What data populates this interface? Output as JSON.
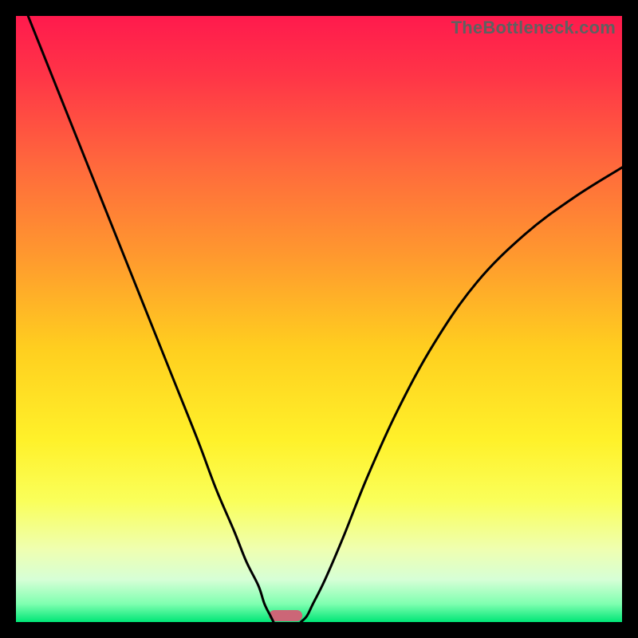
{
  "watermark": "TheBottleneck.com",
  "chart_data": {
    "type": "line",
    "title": "",
    "xlabel": "",
    "ylabel": "",
    "xlim": [
      0,
      100
    ],
    "ylim": [
      0,
      100
    ],
    "series": [
      {
        "name": "left-curve",
        "x": [
          2,
          6,
          10,
          14,
          18,
          22,
          26,
          30,
          33,
          36,
          38,
          40,
          41,
          42,
          42.5
        ],
        "y": [
          100,
          90,
          80,
          70,
          60,
          50,
          40,
          30,
          22,
          15,
          10,
          6,
          3,
          1,
          0
        ]
      },
      {
        "name": "right-curve",
        "x": [
          47,
          48,
          49,
          51,
          54,
          58,
          63,
          69,
          76,
          84,
          92,
          100
        ],
        "y": [
          0,
          1,
          3,
          7,
          14,
          24,
          35,
          46,
          56,
          64,
          70,
          75
        ]
      }
    ],
    "marker": {
      "name": "optimum-marker",
      "x": 44.5,
      "width": 5.5,
      "color": "#cc6677"
    },
    "gradient_stops": [
      {
        "offset": 0.0,
        "color": "#ff1a4d"
      },
      {
        "offset": 0.1,
        "color": "#ff3547"
      },
      {
        "offset": 0.25,
        "color": "#ff6a3c"
      },
      {
        "offset": 0.4,
        "color": "#ff9a2e"
      },
      {
        "offset": 0.55,
        "color": "#ffcf1f"
      },
      {
        "offset": 0.7,
        "color": "#fff12a"
      },
      {
        "offset": 0.8,
        "color": "#faff5a"
      },
      {
        "offset": 0.88,
        "color": "#efffb0"
      },
      {
        "offset": 0.93,
        "color": "#d6ffd6"
      },
      {
        "offset": 0.97,
        "color": "#7fffb0"
      },
      {
        "offset": 1.0,
        "color": "#00e676"
      }
    ]
  }
}
